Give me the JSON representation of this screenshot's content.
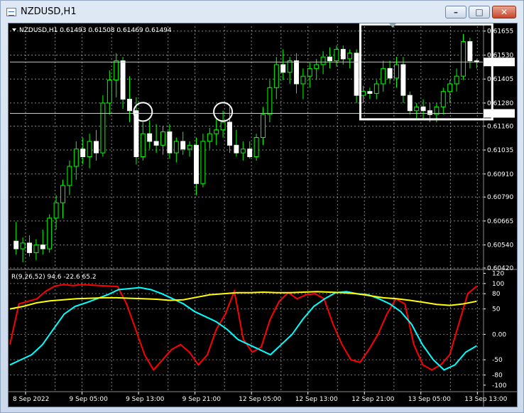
{
  "window": {
    "title": "NZDUSD,H1",
    "buttons": {
      "minimize": "–",
      "maximize": "□",
      "close": "✕"
    }
  },
  "colors": {
    "background": "#000000",
    "grid": "#c0c0c0",
    "candle": "#00ff00",
    "oscillator_fast": "#ff0000",
    "oscillator_slow": "#00ffff",
    "oscillator_signal": "#ffff00",
    "highlight": "#ffffff"
  },
  "chart_data": [
    {
      "type": "candlestick",
      "header": "NZDUSD,H1  0.61493 0.61508 0.61469 0.61494",
      "ylim": [
        0.6042,
        0.6168
      ],
      "y_ticks": [
        "0.61655",
        "0.61530",
        "0.61405",
        "0.61280",
        "0.61160",
        "0.61035",
        "0.60910",
        "0.60790",
        "0.60665",
        "0.60540",
        "0.60420"
      ],
      "price_markers": [
        {
          "label": "0.61494",
          "value": 0.61494
        },
        {
          "label": "0.61226",
          "value": 0.61226
        }
      ],
      "candles": [
        [
          0.6056,
          0.6066,
          0.6049,
          0.6052
        ],
        [
          0.6052,
          0.6058,
          0.6045,
          0.6055
        ],
        [
          0.6055,
          0.6059,
          0.6048,
          0.605
        ],
        [
          0.605,
          0.6057,
          0.6046,
          0.6054
        ],
        [
          0.6054,
          0.6062,
          0.6049,
          0.6052
        ],
        [
          0.6052,
          0.607,
          0.605,
          0.6068
        ],
        [
          0.6068,
          0.608,
          0.6062,
          0.6076
        ],
        [
          0.6076,
          0.6088,
          0.6068,
          0.6085
        ],
        [
          0.6085,
          0.6098,
          0.608,
          0.6095
        ],
        [
          0.6095,
          0.6108,
          0.6088,
          0.6104
        ],
        [
          0.6104,
          0.611,
          0.6096,
          0.61
        ],
        [
          0.61,
          0.6112,
          0.6094,
          0.6108
        ],
        [
          0.6108,
          0.6114,
          0.6098,
          0.6102
        ],
        [
          0.6102,
          0.6132,
          0.61,
          0.6128
        ],
        [
          0.6128,
          0.6145,
          0.6122,
          0.614
        ],
        [
          0.614,
          0.6154,
          0.6131,
          0.615
        ],
        [
          0.615,
          0.6152,
          0.6125,
          0.613
        ],
        [
          0.613,
          0.6142,
          0.6118,
          0.6124
        ],
        [
          0.6124,
          0.6131,
          0.6096,
          0.61
        ],
        [
          0.61,
          0.6118,
          0.6098,
          0.6112
        ],
        [
          0.6112,
          0.6119,
          0.6104,
          0.6108
        ],
        [
          0.6108,
          0.6117,
          0.6102,
          0.6106
        ],
        [
          0.6106,
          0.6116,
          0.6101,
          0.6113
        ],
        [
          0.6113,
          0.6117,
          0.6099,
          0.6102
        ],
        [
          0.6102,
          0.611,
          0.6097,
          0.6108
        ],
        [
          0.6108,
          0.6113,
          0.6101,
          0.6104
        ],
        [
          0.6104,
          0.6108,
          0.61,
          0.6106
        ],
        [
          0.6106,
          0.611,
          0.608,
          0.6086
        ],
        [
          0.6086,
          0.6112,
          0.6084,
          0.6108
        ],
        [
          0.6108,
          0.6115,
          0.6104,
          0.6112
        ],
        [
          0.6112,
          0.612,
          0.6106,
          0.6114
        ],
        [
          0.6114,
          0.6124,
          0.611,
          0.6118
        ],
        [
          0.6118,
          0.6126,
          0.6102,
          0.6106
        ],
        [
          0.6106,
          0.6114,
          0.61,
          0.6102
        ],
        [
          0.6102,
          0.6108,
          0.6098,
          0.6104
        ],
        [
          0.6104,
          0.6108,
          0.6099,
          0.61
        ],
        [
          0.61,
          0.6112,
          0.6098,
          0.611
        ],
        [
          0.611,
          0.6126,
          0.6106,
          0.6122
        ],
        [
          0.6122,
          0.614,
          0.6118,
          0.6136
        ],
        [
          0.6136,
          0.6152,
          0.613,
          0.6148
        ],
        [
          0.6148,
          0.6156,
          0.614,
          0.6144
        ],
        [
          0.6144,
          0.6152,
          0.6138,
          0.615
        ],
        [
          0.615,
          0.6154,
          0.6133,
          0.6138
        ],
        [
          0.6138,
          0.6146,
          0.613,
          0.6142
        ],
        [
          0.6142,
          0.6149,
          0.6136,
          0.6146
        ],
        [
          0.6146,
          0.6151,
          0.614,
          0.6148
        ],
        [
          0.6148,
          0.6155,
          0.6143,
          0.6152
        ],
        [
          0.6152,
          0.6157,
          0.6146,
          0.615
        ],
        [
          0.615,
          0.6158,
          0.6147,
          0.6156
        ],
        [
          0.6156,
          0.6158,
          0.6148,
          0.6151
        ],
        [
          0.6151,
          0.6156,
          0.6146,
          0.6154
        ],
        [
          0.6154,
          0.6156,
          0.6128,
          0.6132
        ],
        [
          0.6132,
          0.6137,
          0.6128,
          0.6134
        ],
        [
          0.6134,
          0.6136,
          0.613,
          0.6133
        ],
        [
          0.6133,
          0.614,
          0.613,
          0.6138
        ],
        [
          0.6138,
          0.615,
          0.6134,
          0.6146
        ],
        [
          0.6146,
          0.615,
          0.6138,
          0.6141
        ],
        [
          0.6141,
          0.6152,
          0.6136,
          0.6148
        ],
        [
          0.6148,
          0.6152,
          0.6128,
          0.6132
        ],
        [
          0.6132,
          0.6134,
          0.6122,
          0.6124
        ],
        [
          0.6124,
          0.6128,
          0.612,
          0.6126
        ],
        [
          0.6126,
          0.613,
          0.612,
          0.6124
        ],
        [
          0.6124,
          0.6128,
          0.6118,
          0.6122
        ],
        [
          0.6122,
          0.6128,
          0.6118,
          0.6126
        ],
        [
          0.6126,
          0.6136,
          0.6122,
          0.6134
        ],
        [
          0.6134,
          0.614,
          0.6128,
          0.6138
        ],
        [
          0.6138,
          0.6146,
          0.6134,
          0.6142
        ],
        [
          0.6142,
          0.6164,
          0.614,
          0.616
        ],
        [
          0.616,
          0.6162,
          0.6146,
          0.615
        ],
        [
          0.615,
          0.6151,
          0.6146,
          0.61494
        ]
      ],
      "x_labels": [
        "8 Sep 2022",
        "9 Sep 05:00",
        "9 Sep 13:00",
        "9 Sep 21:00",
        "12 Sep 05:00",
        "12 Sep 13:00",
        "12 Sep 21:00",
        "13 Sep 05:00",
        "13 Sep 13:00"
      ],
      "annotations": [
        {
          "shape": "circle",
          "center_index": 19,
          "value": 0.61234
        },
        {
          "shape": "circle",
          "center_index": 31,
          "value": 0.61234
        },
        {
          "shape": "rectangle",
          "from_index": 52,
          "to_index": 69,
          "from_value": 0.61195,
          "to_value": 0.6169
        }
      ]
    },
    {
      "type": "line",
      "header": "R(9,26,52) 94.6 -22.6 65.2",
      "ylim": [
        -110,
        125
      ],
      "y_ticks": [
        120,
        100,
        80,
        50,
        0.0,
        -50,
        -80,
        -100
      ],
      "series": [
        {
          "values": [
            -20,
            60,
            65,
            70,
            85,
            95,
            98,
            96,
            98,
            97,
            96,
            95,
            94,
            60,
            10,
            -40,
            -70,
            -50,
            -30,
            -20,
            -35,
            -60,
            -40,
            10,
            40,
            85,
            -10,
            -35,
            -25,
            30,
            65,
            82,
            70,
            78,
            80,
            70,
            20,
            -20,
            -50,
            -55,
            -30,
            0,
            40,
            70,
            60,
            -20,
            -60,
            -70,
            -60,
            -40,
            20,
            80,
            94.6
          ]
        },
        {
          "values": [
            -60,
            -50,
            -40,
            -20,
            10,
            40,
            55,
            62,
            70,
            78,
            88,
            90,
            92,
            88,
            80,
            70,
            60,
            45,
            35,
            25,
            10,
            -10,
            -20,
            -30,
            -40,
            -20,
            0,
            30,
            55,
            70,
            82,
            84,
            80,
            78,
            70,
            60,
            45,
            20,
            -20,
            -50,
            -70,
            -60,
            -35,
            -22.6
          ]
        },
        {
          "values": [
            50,
            55,
            62,
            66,
            68,
            70,
            71,
            72,
            72,
            71,
            70,
            69,
            67,
            68,
            73,
            78,
            80,
            82,
            82,
            83,
            82,
            82,
            83,
            84,
            83,
            82,
            80,
            76,
            72,
            70,
            67,
            63,
            59,
            57,
            60,
            65.2
          ]
        }
      ]
    }
  ]
}
